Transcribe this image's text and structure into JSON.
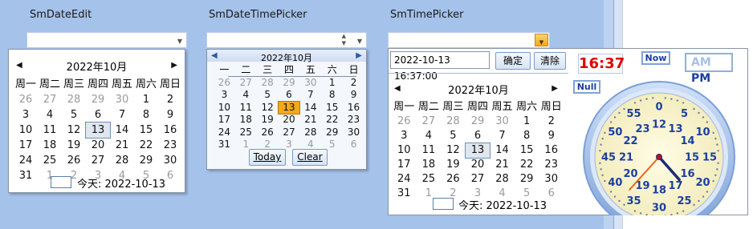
{
  "captions": {
    "date_edit": "SmDateEdit",
    "datetime_picker": "SmDateTimePicker",
    "time_picker": "SmTimePicker"
  },
  "cal1": {
    "title": "2022年10月",
    "weekdays": [
      "周一",
      "周二",
      "周三",
      "周四",
      "周五",
      "周六",
      "周日"
    ],
    "days": [
      [
        "26",
        1
      ],
      [
        "27",
        1
      ],
      [
        "28",
        1
      ],
      [
        "29",
        1
      ],
      [
        "30",
        1
      ],
      [
        "1",
        0
      ],
      [
        "2",
        0
      ],
      [
        "3",
        0
      ],
      [
        "4",
        0
      ],
      [
        "5",
        0
      ],
      [
        "6",
        0
      ],
      [
        "7",
        0
      ],
      [
        "8",
        0
      ],
      [
        "9",
        0
      ],
      [
        "10",
        0
      ],
      [
        "11",
        0
      ],
      [
        "12",
        0
      ],
      [
        "13",
        2
      ],
      [
        "14",
        0
      ],
      [
        "15",
        0
      ],
      [
        "16",
        0
      ],
      [
        "17",
        0
      ],
      [
        "18",
        0
      ],
      [
        "19",
        0
      ],
      [
        "20",
        0
      ],
      [
        "21",
        0
      ],
      [
        "22",
        0
      ],
      [
        "23",
        0
      ],
      [
        "24",
        0
      ],
      [
        "25",
        0
      ],
      [
        "26",
        0
      ],
      [
        "27",
        0
      ],
      [
        "28",
        0
      ],
      [
        "29",
        0
      ],
      [
        "30",
        0
      ],
      [
        "31",
        0
      ],
      [
        "1",
        1
      ],
      [
        "2",
        1
      ],
      [
        "3",
        1
      ],
      [
        "4",
        1
      ],
      [
        "5",
        1
      ],
      [
        "6",
        1
      ]
    ],
    "today_label": "今天: 2022-10-13"
  },
  "cal2": {
    "title": "2022年10月",
    "weekdays": [
      "一",
      "二",
      "三",
      "四",
      "五",
      "六",
      "日"
    ],
    "days": [
      [
        "26",
        1
      ],
      [
        "27",
        1
      ],
      [
        "28",
        1
      ],
      [
        "29",
        1
      ],
      [
        "30",
        1
      ],
      [
        "1",
        0
      ],
      [
        "2",
        0
      ],
      [
        "3",
        0
      ],
      [
        "4",
        0
      ],
      [
        "5",
        0
      ],
      [
        "6",
        0
      ],
      [
        "7",
        0
      ],
      [
        "8",
        0
      ],
      [
        "9",
        0
      ],
      [
        "10",
        0
      ],
      [
        "11",
        0
      ],
      [
        "12",
        0
      ],
      [
        "13",
        2
      ],
      [
        "14",
        0
      ],
      [
        "15",
        0
      ],
      [
        "16",
        0
      ],
      [
        "17",
        0
      ],
      [
        "18",
        0
      ],
      [
        "19",
        0
      ],
      [
        "20",
        0
      ],
      [
        "21",
        0
      ],
      [
        "22",
        0
      ],
      [
        "23",
        0
      ],
      [
        "24",
        0
      ],
      [
        "25",
        0
      ],
      [
        "26",
        0
      ],
      [
        "27",
        0
      ],
      [
        "28",
        0
      ],
      [
        "29",
        0
      ],
      [
        "30",
        0
      ],
      [
        "31",
        0
      ],
      [
        "1",
        1
      ],
      [
        "2",
        1
      ],
      [
        "3",
        1
      ],
      [
        "4",
        1
      ],
      [
        "5",
        1
      ],
      [
        "6",
        1
      ]
    ],
    "today_button": "Today",
    "clear_button": "Clear"
  },
  "picker3": {
    "datetime_value": "2022-10-13  16:37:00",
    "ok_button": "确定",
    "clear_button": "清除",
    "cal": {
      "title": "2022年10月",
      "weekdays": [
        "周一",
        "周二",
        "周三",
        "周四",
        "周五",
        "周六",
        "周日"
      ],
      "days": [
        [
          "26",
          1
        ],
        [
          "27",
          1
        ],
        [
          "28",
          1
        ],
        [
          "29",
          1
        ],
        [
          "30",
          1
        ],
        [
          "1",
          0
        ],
        [
          "2",
          0
        ],
        [
          "3",
          0
        ],
        [
          "4",
          0
        ],
        [
          "5",
          0
        ],
        [
          "6",
          0
        ],
        [
          "7",
          0
        ],
        [
          "8",
          0
        ],
        [
          "9",
          0
        ],
        [
          "10",
          0
        ],
        [
          "11",
          0
        ],
        [
          "12",
          0
        ],
        [
          "13",
          2
        ],
        [
          "14",
          0
        ],
        [
          "15",
          0
        ],
        [
          "16",
          0
        ],
        [
          "17",
          0
        ],
        [
          "18",
          0
        ],
        [
          "19",
          0
        ],
        [
          "20",
          0
        ],
        [
          "21",
          0
        ],
        [
          "22",
          0
        ],
        [
          "23",
          0
        ],
        [
          "24",
          0
        ],
        [
          "25",
          0
        ],
        [
          "26",
          0
        ],
        [
          "27",
          0
        ],
        [
          "28",
          0
        ],
        [
          "29",
          0
        ],
        [
          "30",
          0
        ],
        [
          "31",
          0
        ],
        [
          "1",
          1
        ],
        [
          "2",
          1
        ],
        [
          "3",
          1
        ],
        [
          "4",
          1
        ],
        [
          "5",
          1
        ],
        [
          "6",
          1
        ]
      ],
      "today_label": "今天: 2022-10-13"
    },
    "clock": {
      "time_text": "16:37",
      "now_button": "Now",
      "am_label": "AM",
      "pm_label": "PM",
      "null_button": "Null",
      "hour_value": 16,
      "minute_value": 37,
      "inner_numbers": [
        "12",
        "13",
        "14",
        "15",
        "16",
        "17",
        "18",
        "19",
        "20",
        "21",
        "22",
        "23"
      ],
      "outer_numbers": [
        "0",
        "5",
        "10",
        "15",
        "20",
        "25",
        "30",
        "35",
        "40",
        "45",
        "50",
        "55"
      ]
    }
  },
  "colors": {
    "accent_orange": "#f4a81c",
    "clock_red": "#e00000",
    "clock_blue": "#1b3fa0"
  }
}
